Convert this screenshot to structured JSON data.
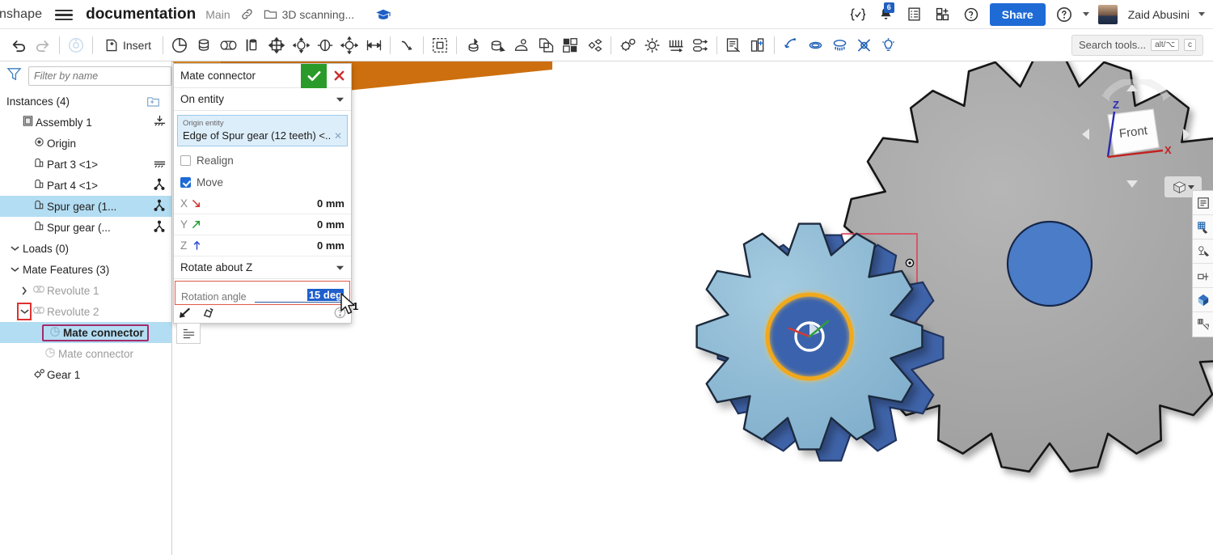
{
  "topbar": {
    "brand": "onshape",
    "menu_icon": "hamburger-icon",
    "document_title": "documentation",
    "branch": "Main",
    "link_icon": "link-icon",
    "folder_icon": "folder-icon",
    "folder_name": "3D scanning...",
    "learning_icon": "graduation-cap-icon",
    "right_icons": [
      {
        "name": "variables-icon",
        "glyph": "{✓}"
      },
      {
        "name": "notifications-bell-icon",
        "badge": "6"
      },
      {
        "name": "tasks-list-icon"
      },
      {
        "name": "apps-grid-icon"
      },
      {
        "name": "ai-assistant-icon"
      }
    ],
    "share_label": "Share",
    "help_icon": "help-circle-icon",
    "user_name": "Zaid Abusini",
    "avatar": "user-avatar"
  },
  "toolbar": {
    "undo_icon": "undo-arrow-icon",
    "redo_icon": "redo-arrow-icon",
    "fix_icon": "fix-target-icon",
    "insert_label": "Insert",
    "insert_icon": "insert-part-icon",
    "tools": [
      "mate-connector-icon",
      "fastened-mate-icon",
      "revolute-mate-icon",
      "slider-mate-icon",
      "planar-mate-icon",
      "cylindrical-mate-icon",
      "pin-slot-mate-icon",
      "ball-mate-icon",
      "parallel-mate-icon",
      "tangent-mate-icon",
      "group-mate-icon",
      "mate-with-offset-icon",
      "replicate-icon",
      "transform-instance-icon",
      "copy-instance-icon",
      "pattern-icon",
      "explode-icon",
      "gear-relation-icon",
      "screw-relation-icon",
      "rack-pinion-relation-icon",
      "linear-relation-icon",
      "bom-icon",
      "insert-exploded-icon",
      "dimension-icon",
      "sketch-ellipse-icon",
      "display-state-icon",
      "section-view-icon",
      "light-icon"
    ],
    "search_placeholder": "Search tools...",
    "search_kbd_1": "alt/⌥",
    "search_kbd_2": "c"
  },
  "sidebar": {
    "filter_icon": "funnel-filter-icon",
    "filter_placeholder": "Filter by name",
    "list_view_icon": "list-view-icon",
    "instances_header": "Instances (4)",
    "add_folder_icon": "add-folder-icon",
    "tree": [
      {
        "label": "Assembly 1",
        "indent": 0,
        "icon": "assembly-icon",
        "twisty": "",
        "right_icon": "fixed-ground-icon",
        "muted": false,
        "selected": false
      },
      {
        "label": "Origin",
        "indent": 1,
        "icon": "origin-point-icon",
        "twisty": "",
        "right_icon": "",
        "muted": false,
        "selected": false
      },
      {
        "label": "Part 3 <1>",
        "indent": 1,
        "icon": "part-instance-icon",
        "twisty": "",
        "right_icon": "ground-hatch-icon",
        "muted": false,
        "selected": false
      },
      {
        "label": "Part 4 <1>",
        "indent": 1,
        "icon": "part-instance-icon",
        "twisty": "",
        "right_icon": "mate-tripod-icon",
        "muted": false,
        "selected": false
      },
      {
        "label": "Spur gear (1...",
        "indent": 1,
        "icon": "part-instance-icon",
        "twisty": "",
        "right_icon": "mate-tripod-icon",
        "muted": false,
        "selected": true
      },
      {
        "label": "Spur gear (...",
        "indent": 1,
        "icon": "part-instance-icon",
        "twisty": "",
        "right_icon": "mate-tripod-icon",
        "muted": false,
        "selected": false
      }
    ],
    "loads_header": "Loads (0)",
    "loads_twisty": "expanded",
    "mate_features_header": "Mate Features (3)",
    "mate_features_twisty": "expanded",
    "mate_tree": [
      {
        "label": "Revolute 1",
        "indent": 1,
        "icon": "revolute-mate-icon",
        "twisty": "collapsed",
        "muted": true,
        "selected": false,
        "highlight": false,
        "boxed": false
      },
      {
        "label": "Revolute 2",
        "indent": 1,
        "icon": "revolute-mate-icon",
        "twisty": "expanded",
        "muted": true,
        "selected": false,
        "highlight": false,
        "boxed": true
      },
      {
        "label": "Mate connector",
        "indent": 2,
        "icon": "mate-connector-icon",
        "twisty": "",
        "muted": false,
        "selected": true,
        "highlight": true,
        "boxed": false
      },
      {
        "label": "Mate connector",
        "indent": 2,
        "icon": "mate-connector-icon",
        "twisty": "",
        "muted": true,
        "selected": false,
        "highlight": false,
        "boxed": false
      },
      {
        "label": "Gear 1",
        "indent": 1,
        "icon": "gear-relation-icon",
        "twisty": "",
        "muted": false,
        "selected": false,
        "highlight": false,
        "boxed": false
      }
    ]
  },
  "mate_connector_dialog": {
    "title": "Mate connector",
    "accept_icon": "checkmark-icon",
    "cancel_icon": "close-x-icon",
    "type_value": "On entity",
    "type_caret": "chevron-down-icon",
    "origin_caption": "Origin entity",
    "origin_value": "Edge of Spur gear (12 teeth) <...",
    "origin_clear_icon": "clear-x-icon",
    "realign_label": "Realign",
    "realign_checked": false,
    "move_label": "Move",
    "move_checked": true,
    "axes": [
      {
        "name": "X",
        "arrow": "x-axis-arrow-icon",
        "value": "0 mm",
        "color": "#d03030"
      },
      {
        "name": "Y",
        "arrow": "y-axis-arrow-icon",
        "value": "0 mm",
        "color": "#1f9a2e"
      },
      {
        "name": "Z",
        "arrow": "z-axis-arrow-icon",
        "value": "0 mm",
        "color": "#2c4fd0"
      }
    ],
    "rotate_about_label": "Rotate about Z",
    "rotation_angle_label": "Rotation angle",
    "rotation_angle_value": "15 deg",
    "flip_icon": "flip-arrow-icon",
    "reorient_icon": "reorient-icon",
    "help_icon": "help-circle-icon"
  },
  "viewport": {
    "cursor_count": "1",
    "view_cube_face": "Front",
    "axis_x_label": "X",
    "axis_z_label": "Z",
    "cube_menu_icon": "view-cube-icon",
    "cube_menu_caret": "chevron-down-icon",
    "selection_box": "selection-rectangle",
    "mini_panel_icon": "feature-list-icon"
  },
  "right_rail": [
    {
      "name": "assembly-list-icon"
    },
    {
      "name": "sketch-plane-icon"
    },
    {
      "name": "mate-connector-pick-icon"
    },
    {
      "name": "section-plane-icon"
    },
    {
      "name": "appearance-icon"
    },
    {
      "name": "measure-icon"
    }
  ],
  "colors": {
    "accent_blue": "#1e6bd6",
    "accept_green": "#2a9b2a",
    "cancel_red": "#cc2b2b",
    "selection_red": "#e0405a",
    "highlight_blue": "#b3ddf2",
    "gear_gray": "#a8a8a8",
    "gear_light_blue": "#8fbcd8",
    "gear_dark_blue": "#3f63a8",
    "hub_blue": "#4a7cc7",
    "hub_gold": "#f0a81e",
    "orange_wedge": "#cd6f0e"
  }
}
